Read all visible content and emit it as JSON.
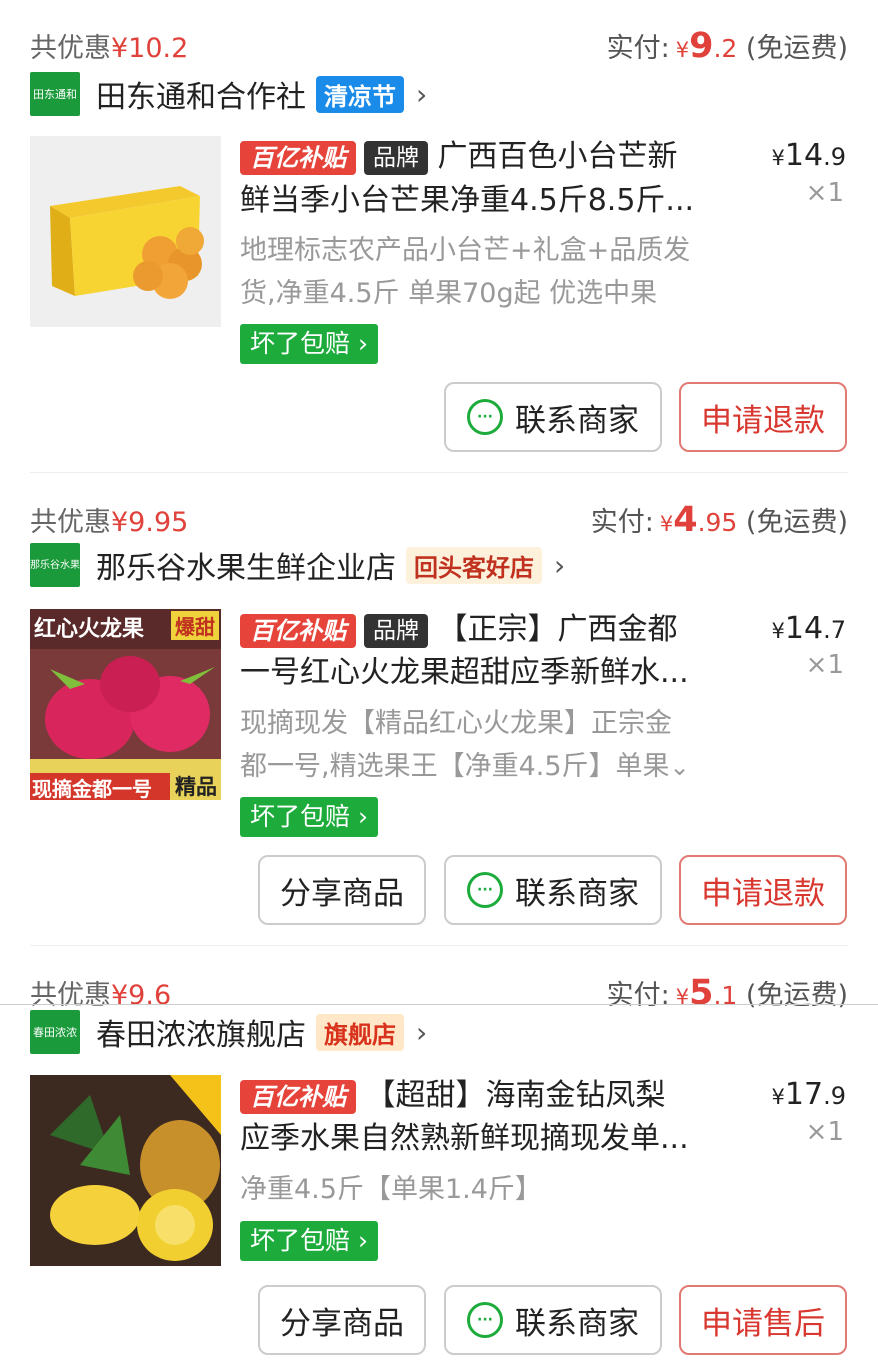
{
  "orders": [
    {
      "discount_label": "共优惠",
      "discount_amount": "¥10.2",
      "paid_label": "实付:",
      "paid_yen": "¥",
      "paid_int": "9",
      "paid_dec": ".2",
      "shipping": "(免运费)",
      "store_logo": "田东通和",
      "store_name": "田东通和合作社",
      "store_tag": "清凉节",
      "chevron": "›",
      "product_badge": "百亿补贴",
      "brand_badge": "品牌",
      "title_line1": "广西百色小台芒新",
      "title_line2": "鲜当季小台芒果净重4.5斤8.5斤...",
      "price_yen": "¥",
      "price_int": "14",
      "price_dec": ".9",
      "qty": "×1",
      "desc_line1": "地理标志农产品小台芒+礼盒+品质发",
      "desc_line2": "货,净重4.5斤 单果70g起 优选中果",
      "guarantee": "坏了包赔 ›",
      "btn_contact": "联系商家",
      "btn_refund": "申请退款"
    },
    {
      "discount_label": "共优惠",
      "discount_amount": "¥9.95",
      "paid_label": "实付:",
      "paid_yen": "¥",
      "paid_int": "4",
      "paid_dec": ".95",
      "shipping": "(免运费)",
      "store_logo": "那乐谷水果",
      "store_name": "那乐谷水果生鲜企业店",
      "store_tag": "回头客好店",
      "chevron": "›",
      "product_badge": "百亿补贴",
      "brand_badge": "品牌",
      "title_line1": "【正宗】广西金都",
      "title_line2": "一号红心火龙果超甜应季新鲜水...",
      "price_yen": "¥",
      "price_int": "14",
      "price_dec": ".7",
      "qty": "×1",
      "desc_line1": "现摘现发【精品红心火龙果】正宗金",
      "desc_line2": "都一号,精选果王【净重4.5斤】单果",
      "desc_expand": "⌄",
      "thumb_text_top": "红心火龙果",
      "thumb_text_tag": "爆甜",
      "thumb_text_bottom": "现摘金都一号",
      "thumb_text_tag2": "精品",
      "guarantee": "坏了包赔 ›",
      "btn_share": "分享商品",
      "btn_contact": "联系商家",
      "btn_refund": "申请退款"
    },
    {
      "discount_label": "共优惠",
      "discount_amount": "¥9.6",
      "paid_label": "实付:",
      "paid_yen": "¥",
      "paid_int": "5",
      "paid_dec": ".1",
      "shipping": "(免运费)",
      "store_logo": "春田浓浓",
      "store_name": "春田浓浓旗舰店",
      "store_tag": "旗舰店",
      "chevron": "›",
      "product_badge": "百亿补贴",
      "title_line1": "【超甜】海南金钻凤梨",
      "title_line2": "应季水果自然熟新鲜现摘现发单...",
      "price_yen": "¥",
      "price_int": "17",
      "price_dec": ".9",
      "qty": "×1",
      "desc_line1": "净重4.5斤【单果1.4斤】",
      "guarantee": "坏了包赔 ›",
      "btn_share": "分享商品",
      "btn_contact": "联系商家",
      "btn_aftersale": "申请售后"
    }
  ],
  "colors": {
    "accent": "#e0413b",
    "green": "#1dac3c",
    "blue_tag": "#1a8be8"
  },
  "icons": [
    "chat-bubble-icon",
    "chevron-right-icon",
    "chevron-down-icon"
  ]
}
